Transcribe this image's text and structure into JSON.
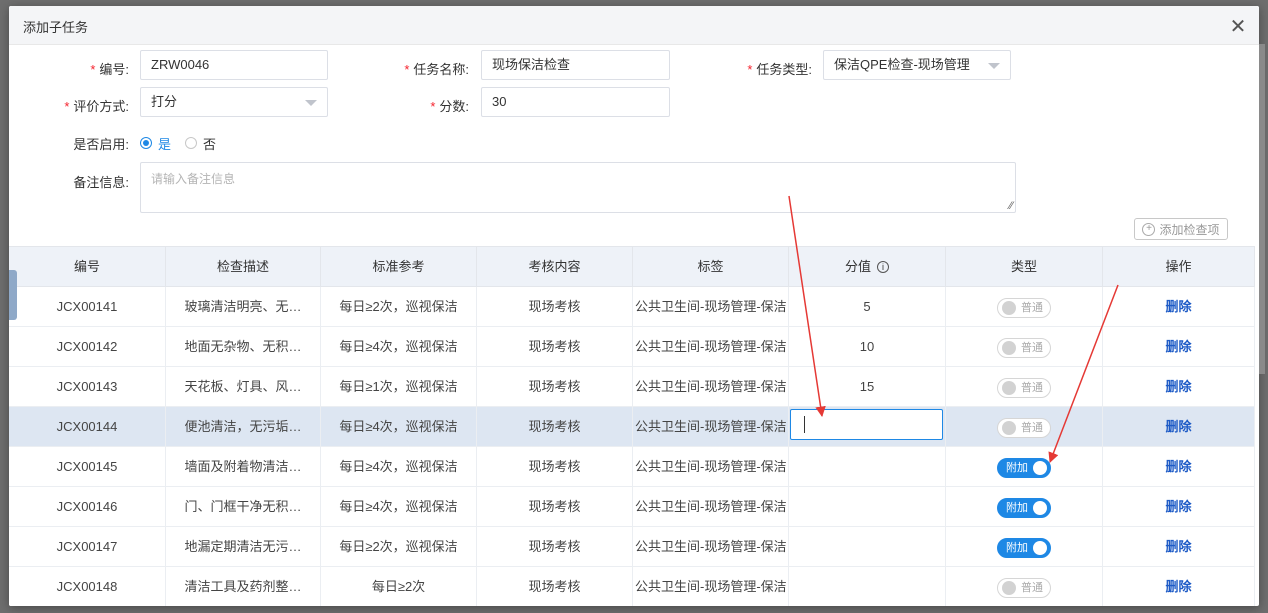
{
  "modal": {
    "title": "添加子任务"
  },
  "form": {
    "code": {
      "label": "编号:",
      "value": "ZRW0046"
    },
    "task_name": {
      "label": "任务名称:",
      "value": "现场保洁检查"
    },
    "task_type": {
      "label": "任务类型:",
      "value": "保洁QPE检查-现场管理"
    },
    "eval_method": {
      "label": "评价方式:",
      "value": "打分"
    },
    "score": {
      "label": "分数:",
      "value": "30"
    },
    "enabled": {
      "label": "是否启用:",
      "options": [
        "是",
        "否"
      ],
      "selected": "是"
    },
    "remark": {
      "label": "备注信息:",
      "placeholder": "请输入备注信息"
    },
    "add_item_label": "添加检查项"
  },
  "table": {
    "headers": [
      "编号",
      "检查描述",
      "标准参考",
      "考核内容",
      "标签",
      "分值",
      "类型",
      "操作"
    ],
    "rows": [
      {
        "code": "JCX00141",
        "desc": "玻璃清洁明亮、无…",
        "std": "每日≥2次，巡视保洁",
        "content": "现场考核",
        "tag": "公共卫生间-现场管理-保洁",
        "score": "5",
        "type": "普通",
        "type_on": false,
        "action": "删除"
      },
      {
        "code": "JCX00142",
        "desc": "地面无杂物、无积…",
        "std": "每日≥4次，巡视保洁",
        "content": "现场考核",
        "tag": "公共卫生间-现场管理-保洁",
        "score": "10",
        "type": "普通",
        "type_on": false,
        "action": "删除"
      },
      {
        "code": "JCX00143",
        "desc": "天花板、灯具、风…",
        "std": "每日≥1次，巡视保洁",
        "content": "现场考核",
        "tag": "公共卫生间-现场管理-保洁",
        "score": "15",
        "type": "普通",
        "type_on": false,
        "action": "删除"
      },
      {
        "code": "JCX00144",
        "desc": "便池清洁，无污垢…",
        "std": "每日≥4次，巡视保洁",
        "content": "现场考核",
        "tag": "公共卫生间-现场管理-保洁",
        "score": "",
        "type": "普通",
        "type_on": false,
        "action": "删除"
      },
      {
        "code": "JCX00145",
        "desc": "墙面及附着物清洁…",
        "std": "每日≥4次，巡视保洁",
        "content": "现场考核",
        "tag": "公共卫生间-现场管理-保洁",
        "score": "",
        "type": "附加",
        "type_on": true,
        "action": "删除"
      },
      {
        "code": "JCX00146",
        "desc": "门、门框干净无积…",
        "std": "每日≥4次，巡视保洁",
        "content": "现场考核",
        "tag": "公共卫生间-现场管理-保洁",
        "score": "",
        "type": "附加",
        "type_on": true,
        "action": "删除"
      },
      {
        "code": "JCX00147",
        "desc": "地漏定期清洁无污…",
        "std": "每日≥2次，巡视保洁",
        "content": "现场考核",
        "tag": "公共卫生间-现场管理-保洁",
        "score": "",
        "type": "附加",
        "type_on": true,
        "action": "删除"
      },
      {
        "code": "JCX00148",
        "desc": "清洁工具及药剂整…",
        "std": "每日≥2次",
        "content": "现场考核",
        "tag": "公共卫生间-现场管理-保洁",
        "score": "",
        "type": "普通",
        "type_on": false,
        "action": "删除"
      }
    ]
  },
  "colors": {
    "accent": "#1e88e5",
    "required": "#f5222d",
    "annotation": "#e53935",
    "link": "#1e5bc6"
  }
}
